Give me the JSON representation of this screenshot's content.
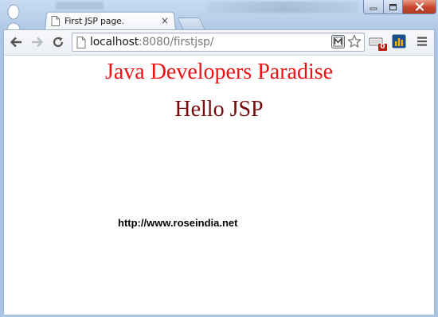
{
  "browser": {
    "tab": {
      "title": "First JSP page.",
      "close_glyph": "×"
    },
    "address": {
      "host": "localhost",
      "rest": ":8080/firstjsp/"
    },
    "icons": {
      "back": "back-arrow-icon",
      "forward": "forward-arrow-icon",
      "reload": "reload-icon",
      "page": "page-icon",
      "bookmark": "star-icon",
      "extension_m": "m-extension-icon",
      "extension_badge": "badge-extension-icon",
      "extension_chart": "chart-extension-icon",
      "menu": "hamburger-menu-icon"
    },
    "extension_badge_count": "0"
  },
  "page": {
    "heading": "Java Developers Paradise",
    "subheading": "Hello JSP",
    "link_text": "http://www.roseindia.net"
  },
  "colors": {
    "heading": "#ee1111",
    "subheading": "#7a0a0a",
    "close_button": "#c8452c",
    "badge": "#cc1111",
    "chart_icon": "#1b4f8a"
  }
}
